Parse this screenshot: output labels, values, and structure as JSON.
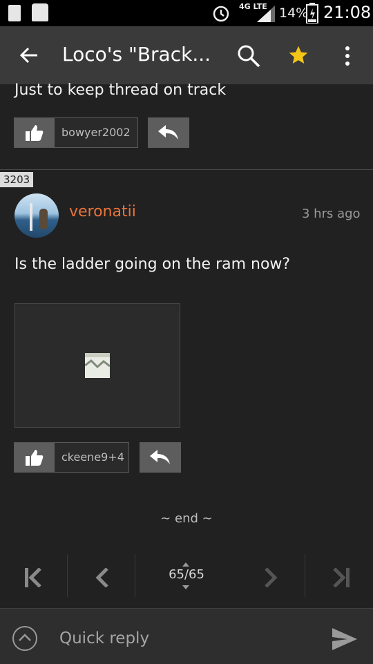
{
  "status": {
    "battery": "14%",
    "time": "21:08",
    "network": "4G LTE"
  },
  "appbar": {
    "title": "Loco's \"Brack..."
  },
  "colors": {
    "accent_username": "#e8743b",
    "star": "#f5c518",
    "background": "#212121",
    "toolbar": "#3a3a3a"
  },
  "prev_post": {
    "text": "Just to keep thread on track",
    "liked_by": "bowyer2002"
  },
  "post": {
    "number": "3203",
    "username": "veronatii",
    "time": "3 hrs ago",
    "text": "Is the ladder going on the ram now?",
    "liked_by": "ckeene9+4",
    "image_state": "broken-image"
  },
  "footer": {
    "end_label": "~ end ~",
    "page_indicator": "65/65"
  },
  "quick_reply": {
    "placeholder": "Quick reply"
  },
  "icons": [
    "back-arrow-icon",
    "search-icon",
    "star-icon",
    "more-vert-icon",
    "thumbs-up-icon",
    "reply-arrow-icon",
    "broken-image-icon",
    "first-page-icon",
    "prev-page-icon",
    "next-page-icon",
    "last-page-icon",
    "chevron-up-icon",
    "send-icon",
    "alarm-icon",
    "signal-icon",
    "battery-icon"
  ]
}
